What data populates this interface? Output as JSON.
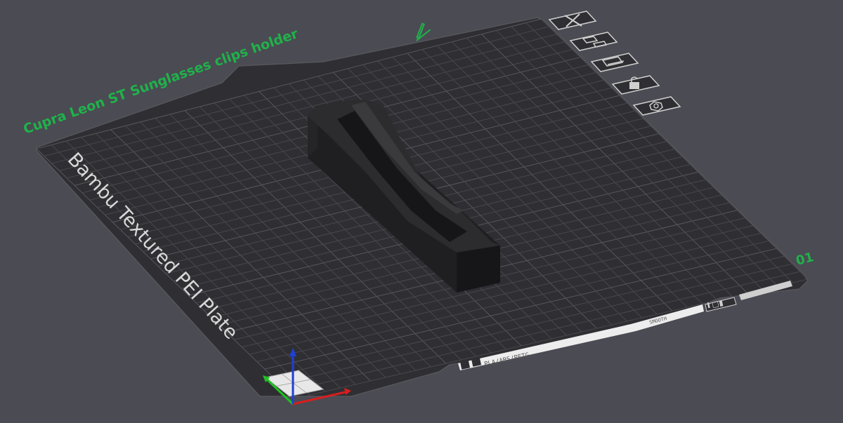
{
  "plate": {
    "name": "Cupra Leon ST Sunglasses clips holder",
    "number": "01",
    "plate_type_label": "Bambu Textured PEI Plate",
    "bottom_strip_text": "PLA/ABS/PETG",
    "rating_text": "SMOOTH"
  },
  "toolbar": [
    {
      "icon": "close-icon",
      "label": "Delete plate"
    },
    {
      "icon": "arrange-icon",
      "label": "Auto arrange"
    },
    {
      "icon": "orient-icon",
      "label": "Auto orient"
    },
    {
      "icon": "lock-icon",
      "label": "Lock plate"
    },
    {
      "icon": "settings-icon",
      "label": "Plate settings"
    }
  ],
  "colors": {
    "background": "#4b4b53",
    "plate": "#2f2f33",
    "grid": "#4a4a50",
    "plate_name": "#1fb24a",
    "model_top": "#2b2b2d",
    "model_side": "#1e1e20",
    "axis_x": "#d61f1f",
    "axis_y": "#1fc21f",
    "axis_z": "#1f3fd6"
  }
}
